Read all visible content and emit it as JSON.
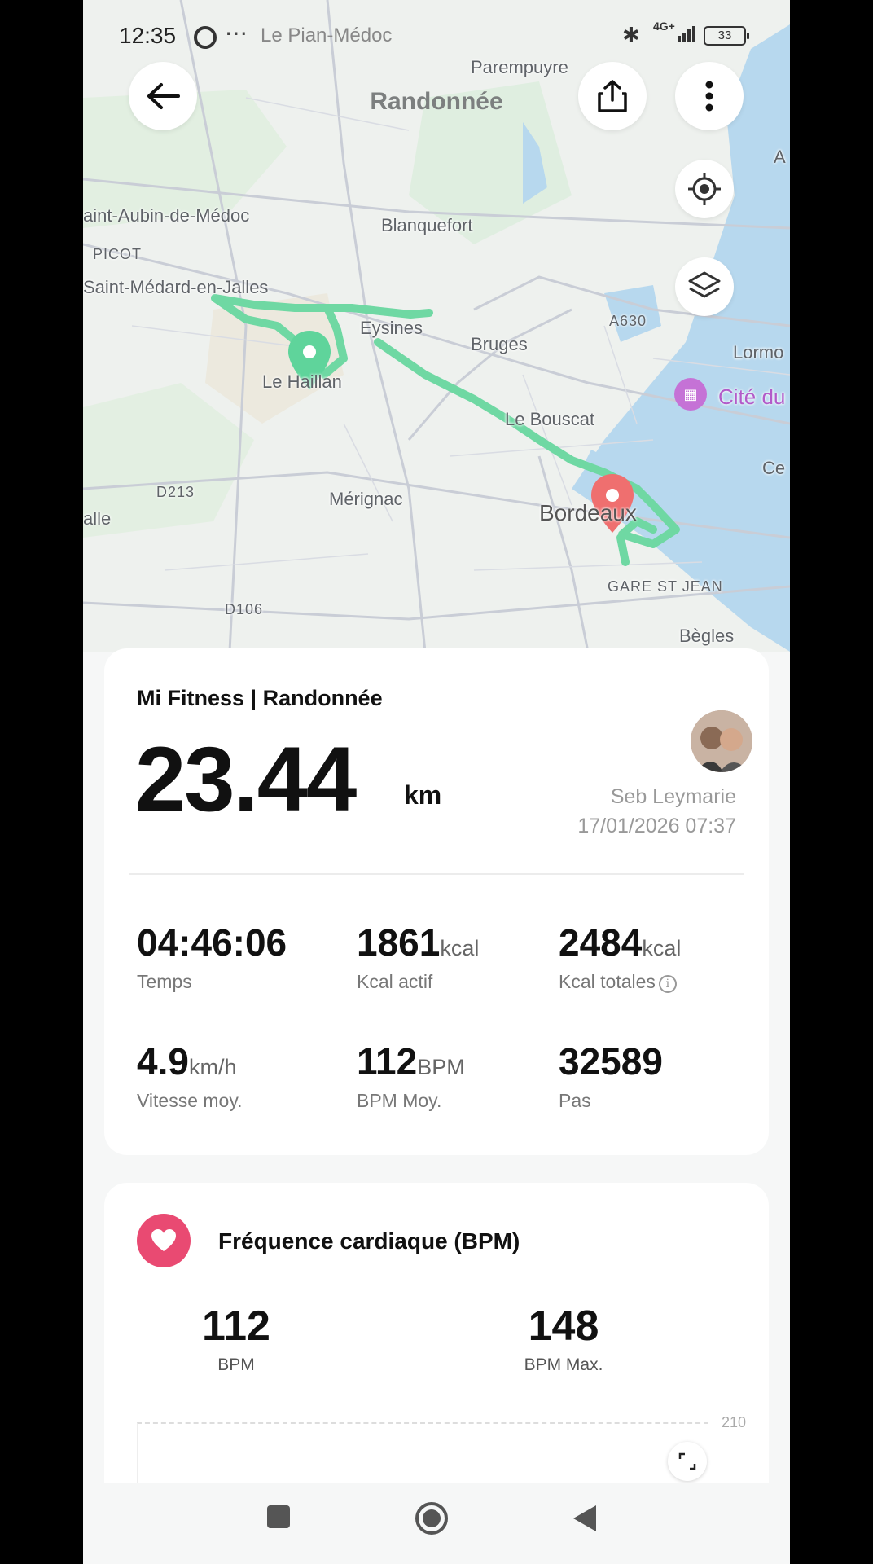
{
  "status_bar": {
    "time": "12:35",
    "location_text": "Le Pian-Médoc",
    "network": "4G+",
    "battery": "33"
  },
  "header": {
    "title": "Randonnée"
  },
  "map": {
    "labels": {
      "parempuyre": "Parempuyre",
      "saint_aubin": "aint-Aubin-de-Médoc",
      "blanquefort": "Blanquefort",
      "picot": "PICOT",
      "saint_medard": "Saint-Médard-en-Jalles",
      "eysines": "Eysines",
      "a630": "A630",
      "bruges": "Bruges",
      "lormont": "Lormo",
      "le_haillan": "Le Haillan",
      "cite_du": "Cité du",
      "le_bouscat": "Le Bouscat",
      "cenon": "Ce",
      "d213": "D213",
      "merignac": "Mérignac",
      "bordeaux": "Bordeaux",
      "halle": "alle",
      "gare": "GARE ST JEAN",
      "d106": "D106",
      "begles": "Bègles",
      "a_edge": "A",
      "c_edge": "C"
    },
    "route_color": "#6fd8a3",
    "start_marker_color": "#5fd49b",
    "end_marker_color": "#ef6f6f"
  },
  "summary": {
    "app_activity": "Mi Fitness | Randonnée",
    "distance": "23.44",
    "distance_unit": "km",
    "user_name": "Seb Leymarie",
    "datetime": "17/01/2026 07:37",
    "stats": [
      {
        "value": "04:46:06",
        "unit": "",
        "label": "Temps"
      },
      {
        "value": "1861",
        "unit": "kcal",
        "label": "Kcal actif"
      },
      {
        "value": "2484",
        "unit": "kcal",
        "label": "Kcal totales"
      },
      {
        "value": "4.9",
        "unit": "km/h",
        "label": "Vitesse moy."
      },
      {
        "value": "112",
        "unit": "BPM",
        "label": "BPM Moy."
      },
      {
        "value": "32589",
        "unit": "",
        "label": "Pas"
      }
    ]
  },
  "heart_rate": {
    "title": "Fréquence cardiaque (BPM)",
    "avg_value": "112",
    "avg_label": "BPM",
    "max_value": "148",
    "max_label": "BPM Max.",
    "chart_ymax": "210",
    "accent": "#e94a72"
  }
}
